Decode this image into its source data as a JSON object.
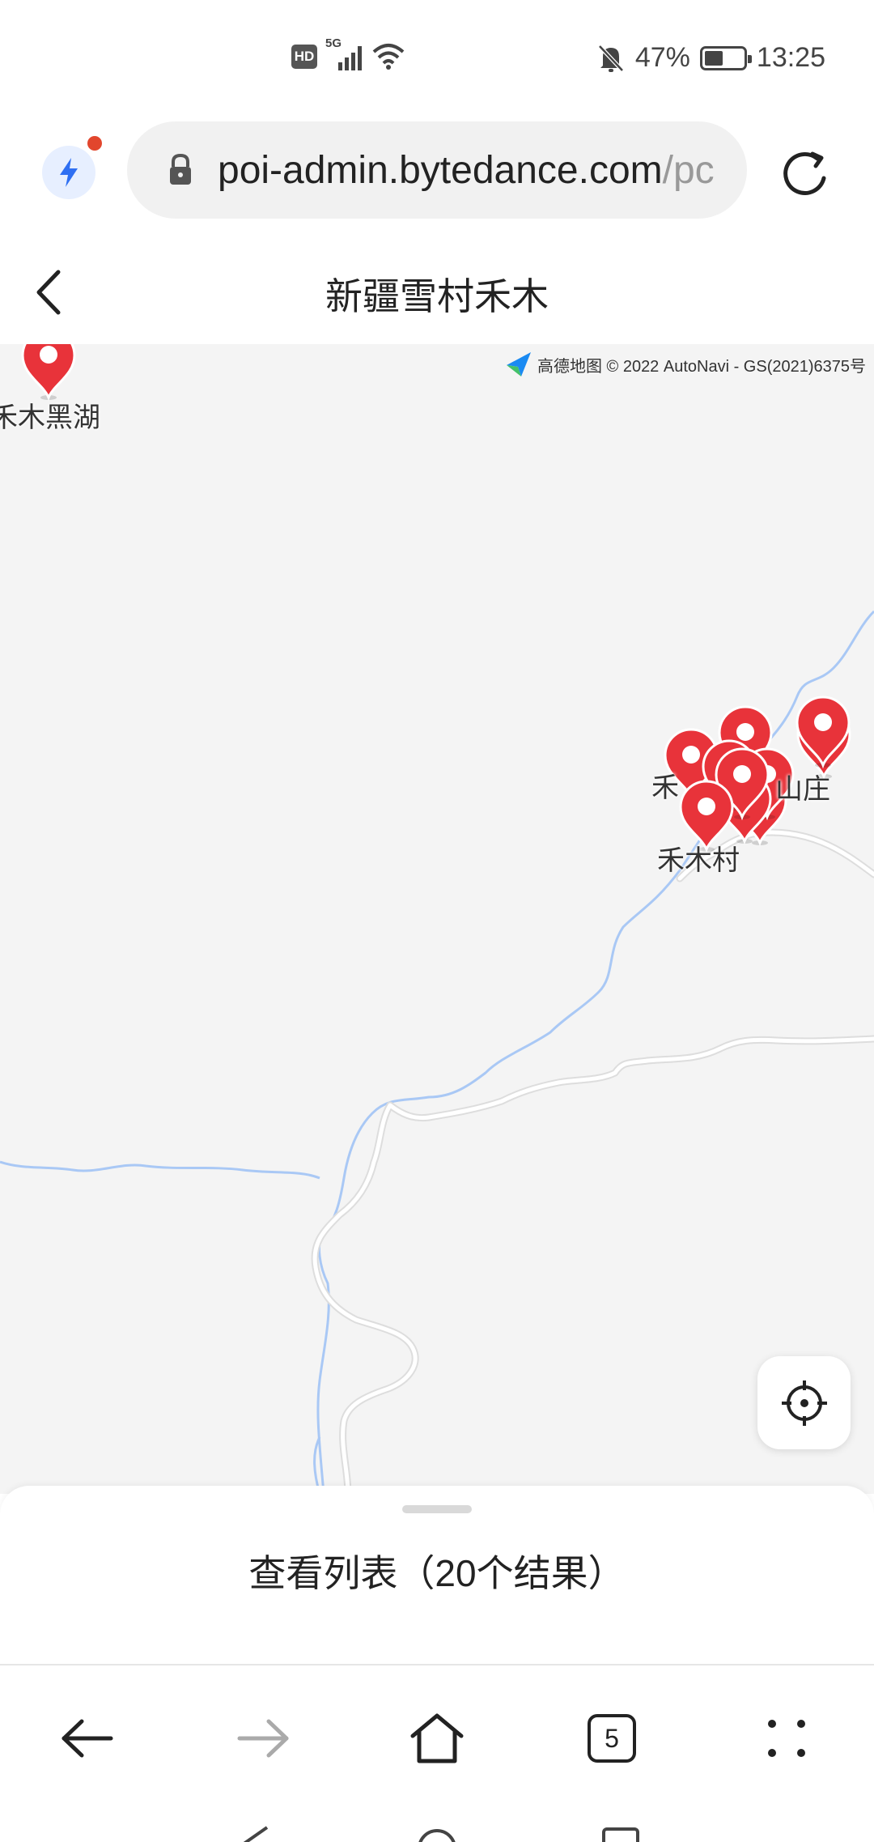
{
  "status_bar": {
    "hd": "HD",
    "network": "5G",
    "battery": "47%",
    "time": "13:25"
  },
  "browser": {
    "url_main": "poi-admin.bytedance.com",
    "url_rest": "/pc"
  },
  "header": {
    "title": "新疆雪村禾木"
  },
  "map": {
    "copyright": "高德地图 © 2022 AutoNavi - GS(2021)6375号",
    "poi_labels": {
      "hemu_lake": "禾木黑湖",
      "hemu_cluster": "禾",
      "villa": "山庄",
      "hemu_village": "禾木村"
    },
    "marker_color": "#e8333a",
    "river_color": "#a9c8f5",
    "road_color": "#ffffff"
  },
  "sheet": {
    "label": "查看列表（20个结果）"
  },
  "bottom_nav": {
    "tab_count": "5"
  }
}
